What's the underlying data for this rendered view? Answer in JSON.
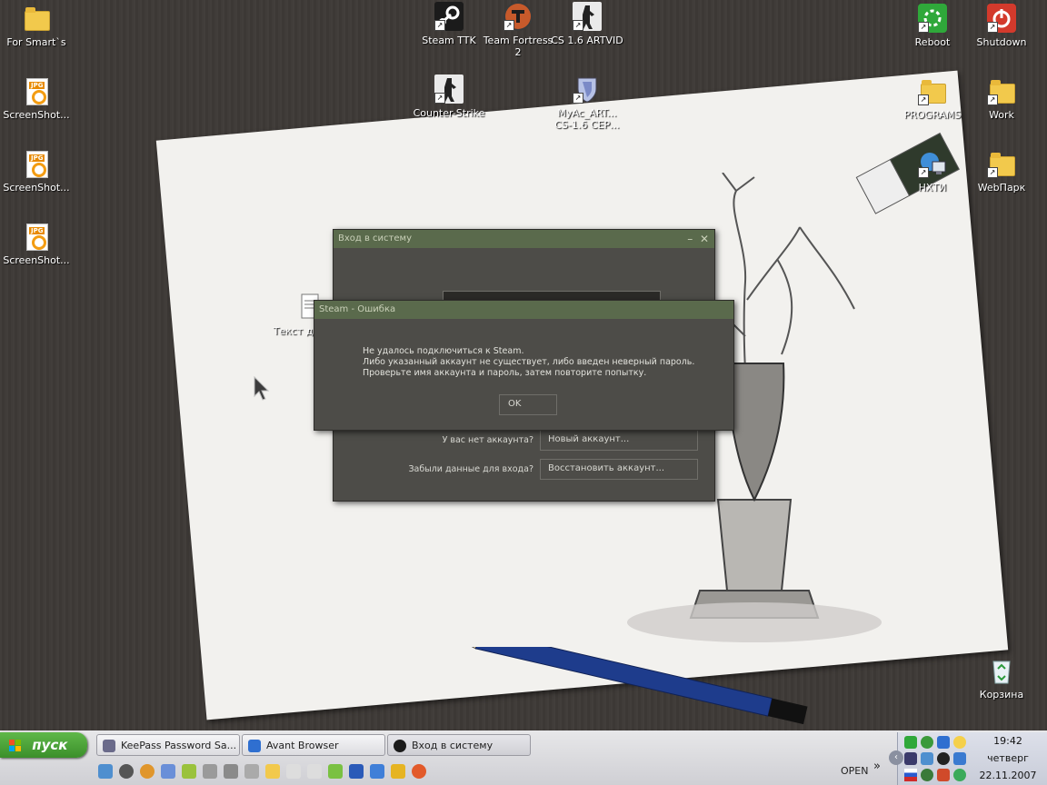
{
  "desktop": {
    "icons": [
      {
        "id": "for-smarts",
        "label": "For Smart`s",
        "type": "folder"
      },
      {
        "id": "screenshot-1",
        "label": "ScreenShot...",
        "type": "jpg"
      },
      {
        "id": "screenshot-2",
        "label": "ScreenShot...",
        "type": "jpg"
      },
      {
        "id": "screenshot-3",
        "label": "ScreenShot...",
        "type": "jpg"
      },
      {
        "id": "steam-ttk",
        "label": "Steam TTK",
        "type": "steam"
      },
      {
        "id": "team-fortress",
        "label": "Team Fortress 2",
        "type": "tf2"
      },
      {
        "id": "cs16-artvid",
        "label": "CS 1.6 ARTVID",
        "type": "cs"
      },
      {
        "id": "counter-strike",
        "label": "Counter-Strike",
        "type": "cs"
      },
      {
        "id": "myac",
        "label": "MyAc_ART... CS-1.6 СЕР...",
        "type": "shield"
      },
      {
        "id": "reboot",
        "label": "Reboot",
        "type": "reboot"
      },
      {
        "id": "shutdown",
        "label": "Shutdown",
        "type": "shutdown"
      },
      {
        "id": "programs",
        "label": "PROGRAMS",
        "type": "folder"
      },
      {
        "id": "work",
        "label": "Work",
        "type": "folder"
      },
      {
        "id": "nhti",
        "label": "НХТИ",
        "type": "network"
      },
      {
        "id": "webpark",
        "label": "WebПарк",
        "type": "folder"
      },
      {
        "id": "trash",
        "label": "Корзина",
        "type": "recycle"
      },
      {
        "id": "text-doc",
        "label": "Текст докуме",
        "type": "doc"
      }
    ],
    "colors": {
      "steam_title": "#5a6a4c",
      "steam_body": "#4d4c48"
    }
  },
  "login_window": {
    "title": "Вход в систему",
    "no_account_label": "У вас нет аккаунта?",
    "new_account_button": "Новый аккаунт...",
    "forgot_label": "Забыли данные для входа?",
    "recover_button": "Восстановить аккаунт..."
  },
  "error_dialog": {
    "title": "Steam - Ошибка",
    "line1": "Не удалось подключиться к Steam.",
    "line2": "Либо указанный аккаунт не существует, либо введен неверный пароль.",
    "line3": "Проверьте имя аккаунта и пароль, затем повторите попытку.",
    "ok_button": "OK"
  },
  "taskbar": {
    "start_label": "пуск",
    "tasks": [
      {
        "label": "KeePass Password Sa..."
      },
      {
        "label": "Avant Browser"
      },
      {
        "label": "Вход в систему"
      }
    ],
    "open_label": "OPEN",
    "clock": {
      "time": "19:42",
      "day": "четверг",
      "date": "22.11.2007"
    }
  }
}
